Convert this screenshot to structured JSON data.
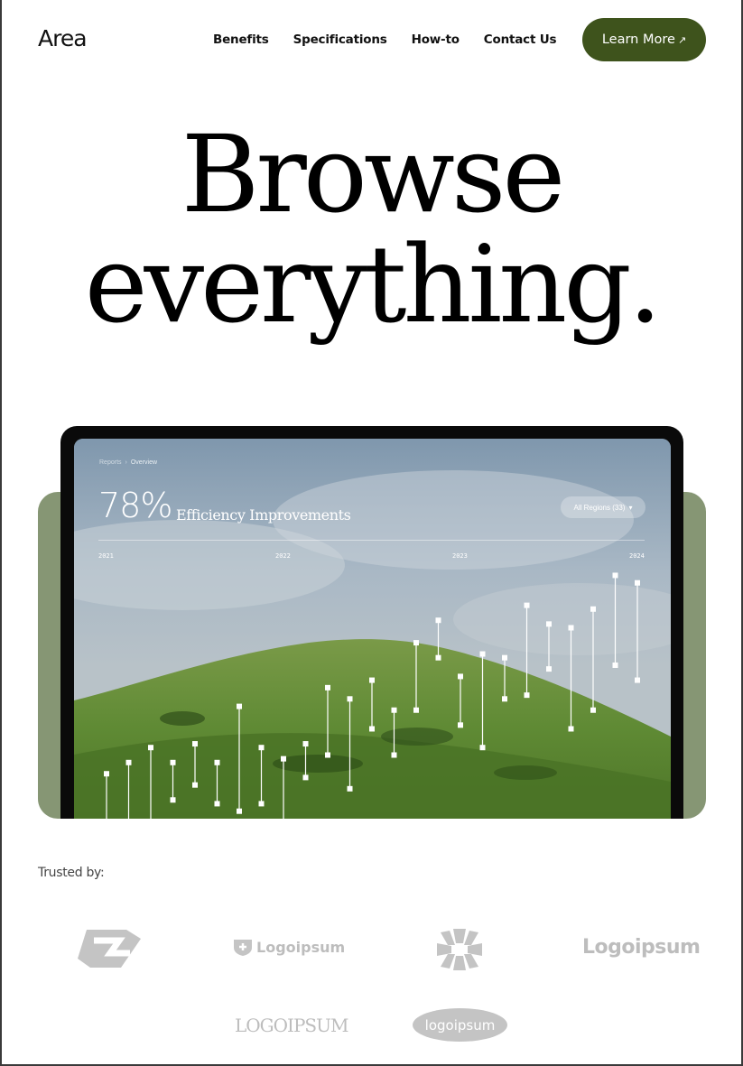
{
  "header": {
    "logo": "Area",
    "nav": [
      "Benefits",
      "Specifications",
      "How-to",
      "Contact Us"
    ],
    "cta_label": "Learn More",
    "cta_icon": "arrow-up-right-icon",
    "cta_color": "#3e531c"
  },
  "hero": {
    "line1": "Browse",
    "line2": "everything."
  },
  "dashboard": {
    "breadcrumb": [
      "Reports",
      "Overview"
    ],
    "kpi_value": "78%",
    "kpi_label": "Efficiency Improvements",
    "region_select": "All Regions (33)",
    "years": [
      "2021",
      "2022",
      "2023",
      "2024"
    ]
  },
  "chart_data": {
    "type": "range",
    "description_note": "",
    "ranges": [
      [
        0.12,
        0.0
      ],
      [
        0.15,
        0.0
      ],
      [
        0.19,
        0.0
      ],
      [
        0.15,
        0.05
      ],
      [
        0.2,
        0.09
      ],
      [
        0.15,
        0.04
      ],
      [
        0.3,
        0.02
      ],
      [
        0.19,
        0.04
      ],
      [
        0.16,
        0.0
      ],
      [
        0.2,
        0.11
      ],
      [
        0.35,
        0.17
      ],
      [
        0.32,
        0.08
      ],
      [
        0.37,
        0.24
      ],
      [
        0.29,
        0.17
      ],
      [
        0.47,
        0.29
      ],
      [
        0.53,
        0.43
      ],
      [
        0.38,
        0.25
      ],
      [
        0.44,
        0.19
      ],
      [
        0.43,
        0.32
      ],
      [
        0.57,
        0.33
      ],
      [
        0.52,
        0.4
      ],
      [
        0.51,
        0.24
      ],
      [
        0.56,
        0.29
      ],
      [
        0.65,
        0.41
      ],
      [
        0.63,
        0.37
      ]
    ]
  },
  "trusted": {
    "label": "Trusted by:",
    "logos": [
      "Logoipsum",
      "Logoipsum",
      "LOGOIPSUM",
      "logoipsum"
    ]
  }
}
